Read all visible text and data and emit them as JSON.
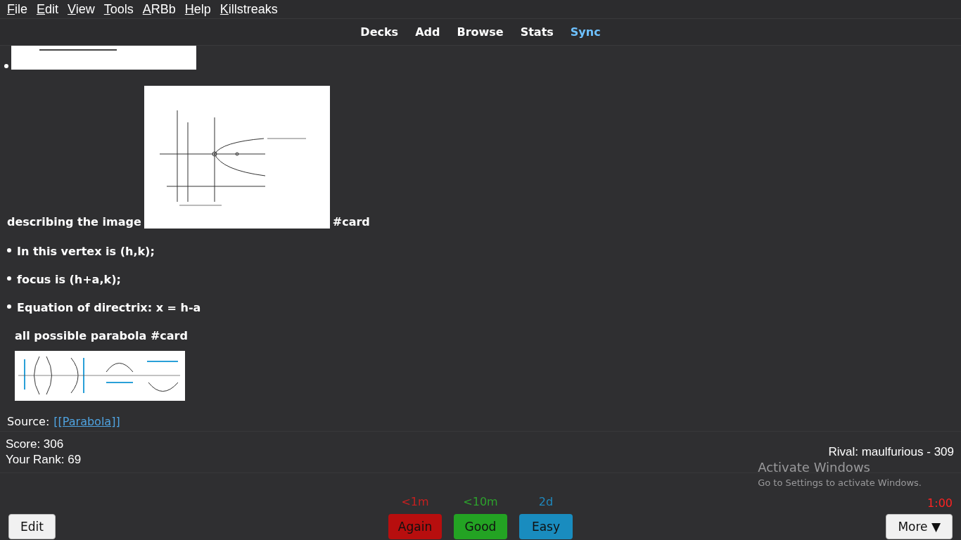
{
  "menu": [
    "File",
    "Edit",
    "View",
    "Tools",
    "ARBb",
    "Help",
    "Killstreaks"
  ],
  "toolbar": [
    {
      "label": "Decks",
      "highlighted": false
    },
    {
      "label": "Add",
      "highlighted": false
    },
    {
      "label": "Browse",
      "highlighted": false
    },
    {
      "label": "Stats",
      "highlighted": false
    },
    {
      "label": "Sync",
      "highlighted": true
    }
  ],
  "card": {
    "image_line": {
      "before": "describing the image",
      "after": "#card"
    },
    "bullets": [
      "In this vertex is (h,k);",
      "focus is (h+a,k);",
      "Equation of directrix: x = h-a"
    ],
    "heading": "all possible parabola #card",
    "source": {
      "label": "Source:",
      "link": "[[Parabola]]"
    }
  },
  "status": {
    "score": "Score: 306",
    "rank": "Your Rank: 69",
    "rival": "Rival: maulfurious - 309"
  },
  "bottom": {
    "edit": "Edit",
    "more": "More ▼",
    "timer": "1:00",
    "answers": [
      {
        "kind": "again",
        "interval": "<1m",
        "label": "Again"
      },
      {
        "kind": "good",
        "interval": "<10m",
        "label": "Good"
      },
      {
        "kind": "easy",
        "interval": "2d",
        "label": "Easy"
      }
    ]
  },
  "os_notice": {
    "title": "Activate Windows",
    "subtitle": "Go to Settings to activate Windows."
  }
}
